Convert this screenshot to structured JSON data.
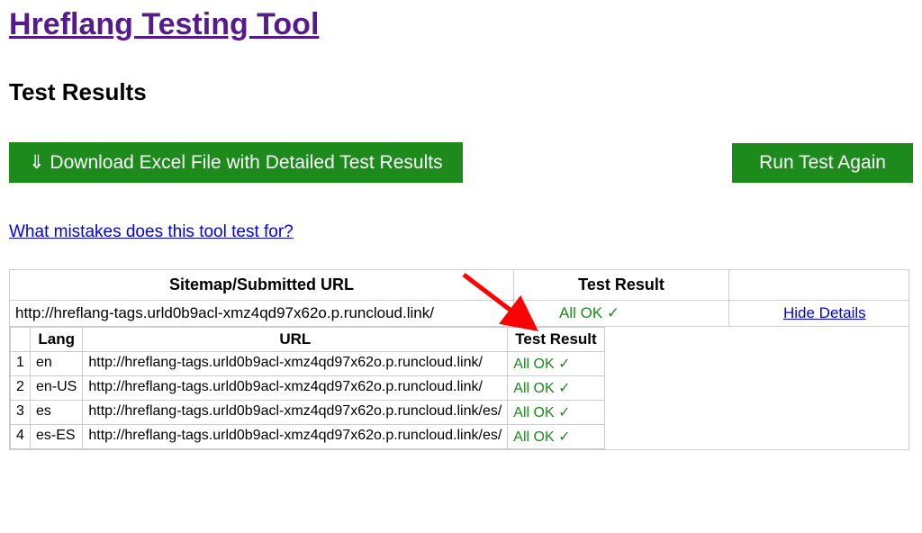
{
  "header": {
    "title": "Hreflang Testing Tool"
  },
  "section": {
    "heading": "Test Results"
  },
  "buttons": {
    "download": "⇓ Download Excel File with Detailed Test Results",
    "run_again": "Run Test Again"
  },
  "links": {
    "faq": "What mistakes does this tool test for?",
    "hide_details": "Hide Details"
  },
  "summary_table": {
    "headers": {
      "submitted": "Sitemap/Submitted URL",
      "result": "Test Result"
    },
    "row": {
      "url": "http://hreflang-tags.urld0b9acl-xmz4qd97x62o.p.runcloud.link/",
      "result": "All OK ✓"
    }
  },
  "detail_table": {
    "headers": {
      "lang": "Lang",
      "url": "URL",
      "result": "Test Result"
    },
    "rows": [
      {
        "idx": "1",
        "lang": "en",
        "url": "http://hreflang-tags.urld0b9acl-xmz4qd97x62o.p.runcloud.link/",
        "result": "All OK ✓"
      },
      {
        "idx": "2",
        "lang": "en-US",
        "url": "http://hreflang-tags.urld0b9acl-xmz4qd97x62o.p.runcloud.link/",
        "result": "All OK ✓"
      },
      {
        "idx": "3",
        "lang": "es",
        "url": "http://hreflang-tags.urld0b9acl-xmz4qd97x62o.p.runcloud.link/es/",
        "result": "All OK ✓"
      },
      {
        "idx": "4",
        "lang": "es-ES",
        "url": "http://hreflang-tags.urld0b9acl-xmz4qd97x62o.p.runcloud.link/es/",
        "result": "All OK ✓"
      }
    ]
  },
  "colors": {
    "green": "#1c8b1c",
    "link_blue": "#0000EE",
    "visited_purple": "#551A8B"
  }
}
